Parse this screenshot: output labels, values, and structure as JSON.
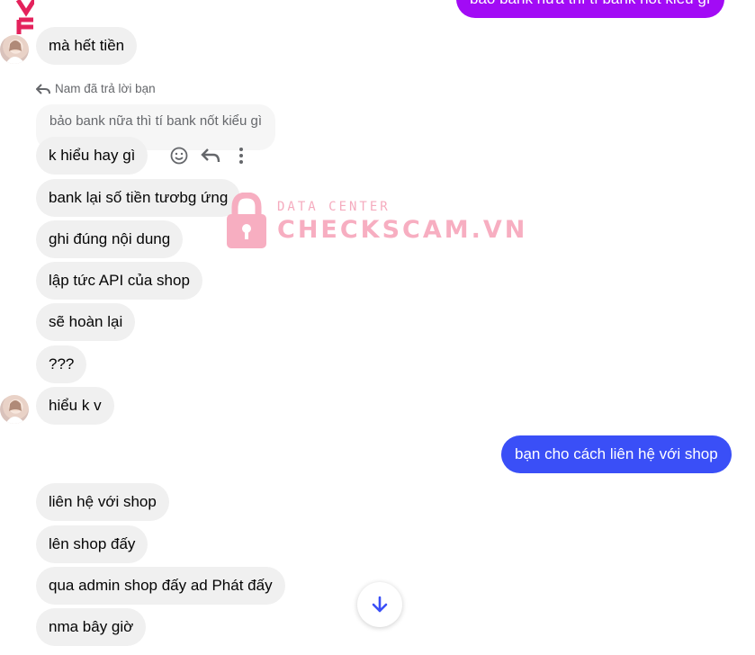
{
  "top_sent_message": "bảo bank nữa thì tí bank nốt kiểu gì",
  "reply_context": {
    "label": "Nam đã trả lời bạn",
    "quoted_text": "bảo bank nữa thì tí bank nốt kiểu gì"
  },
  "received_group_1": [
    "mà hết tiền"
  ],
  "received_group_2": [
    "k hiểu hay gì",
    "bank lại số tiền tươbg ứng",
    "ghi đúng nội dung",
    "lập tức API của shop",
    "sẽ hoàn lại",
    "???",
    "hiểu k v"
  ],
  "sent_message": "bạn cho cách liên hệ với shop",
  "received_group_3": [
    "liên hệ với shop",
    "lên shop đấy",
    "qua admin shop đấy ad Phát đấy",
    "nma bây giờ"
  ],
  "watermark": {
    "line1": "DATA CENTER",
    "line2": "CHECKSCAM.VN"
  },
  "colors": {
    "sent_purple": "#a20bf5",
    "sent_blue": "#3a4ff7",
    "received_bg": "#f0f0f0",
    "watermark_pink": "#f7a6bb"
  },
  "icons": [
    "react-smiley-icon",
    "reply-icon",
    "more-options-icon",
    "scroll-down-arrow-icon",
    "reply-arrow-icon"
  ]
}
